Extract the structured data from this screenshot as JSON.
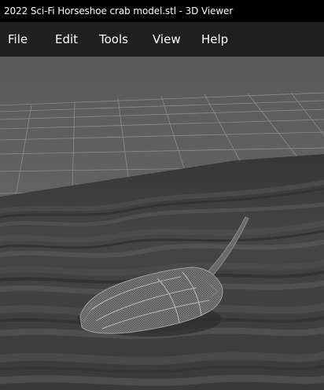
{
  "window": {
    "title": "2022 Sci-Fi Horseshoe crab model.stl - 3D Viewer"
  },
  "menu": {
    "items": [
      {
        "label": "File"
      },
      {
        "label": "Edit"
      },
      {
        "label": "Tools"
      },
      {
        "label": "View"
      },
      {
        "label": "Help"
      }
    ]
  },
  "viewport": {
    "model": "horseshoe-crab-wireframe",
    "background_color": "#5f5f5f",
    "terrain_color": "#3d3d3d",
    "grid_color": "#8a8a8a"
  }
}
